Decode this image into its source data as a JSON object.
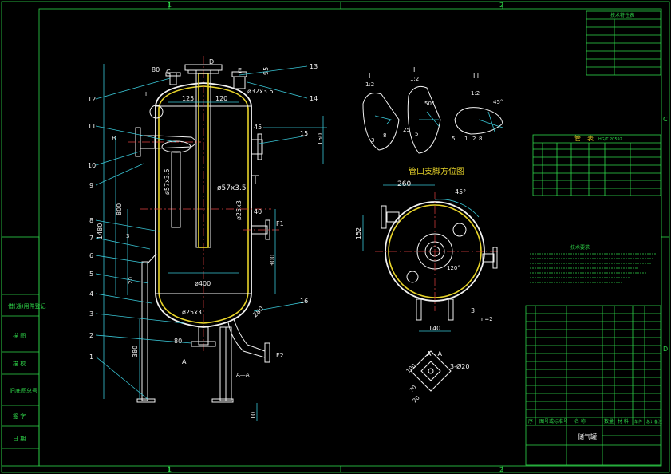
{
  "border_zones": {
    "top_1": "1",
    "top_2": "2",
    "bottom_1": "1",
    "bottom_2": "2",
    "right_c": "C",
    "right_d": "D"
  },
  "left_strip": [
    "借(通)用件登记",
    "描  图",
    "描  校",
    "旧底图总号",
    "签  字",
    "日  期"
  ],
  "vessel_labels": {
    "nozzle_c": "C",
    "nozzle_d": "D",
    "nozzle_e": "E",
    "nozzle_b": "B",
    "nozzle_f1": "F1",
    "nozzle_f2": "F2",
    "nozzle_a": "A",
    "section_aa": "A—A",
    "detail_i": "I"
  },
  "part_numbers": [
    "1",
    "2",
    "3",
    "4",
    "5",
    "6",
    "7",
    "8",
    "9",
    "10",
    "11",
    "12",
    "13",
    "14",
    "15",
    "16"
  ],
  "dims": {
    "d80_top": "80",
    "d95": "95",
    "d125": "125",
    "d120": "120",
    "d32": "ø32x3.5",
    "d45": "45",
    "d150": "150",
    "d800": "800",
    "d1480": "1480",
    "d57": "ø57x3.5",
    "d57b": "ø57x3.5",
    "d25a": "ø25x3",
    "d40": "40",
    "d300": "300",
    "d400": "ø400",
    "d25b": "ø25x3",
    "d280": "280",
    "d380": "380",
    "d80_bot": "80",
    "d10": "10",
    "d20": "20",
    "d3": "3"
  },
  "details": {
    "i_title": "I",
    "i_scale": "1:2",
    "ii_title": "II",
    "ii_scale": "1:2",
    "iii_title": "III",
    "iii_scale": "1:2",
    "d3": "3",
    "d8": "8",
    "d45": "45°",
    "d5": "5",
    "d25": "25",
    "d5b": "5",
    "d8b": "8",
    "d1": "1",
    "d2": "2",
    "d50": "50°"
  },
  "orientation": {
    "title": "管口支脚方位图",
    "d260": "260",
    "d45": "45°",
    "d152": "152",
    "d140": "140",
    "d120": "120°",
    "leg": "3",
    "n2": "n=2"
  },
  "aa_view": {
    "title": "A—A",
    "d100": "100",
    "d70": "70",
    "d20": "20",
    "d3o20": "3-Ø20"
  },
  "tech_table": {
    "title": "技术特性表",
    "rows": [
      [
        "",
        "",
        ""
      ],
      [
        "",
        "",
        ""
      ],
      [
        "",
        "",
        ""
      ],
      [
        "",
        "",
        ""
      ],
      [
        "",
        "",
        ""
      ],
      [
        "",
        "",
        ""
      ],
      [
        "",
        "",
        ""
      ]
    ]
  },
  "nozzle_table": {
    "title": "管口表",
    "subtitle": "HG/T 20592",
    "headers": [
      "",
      "",
      "",
      "",
      "",
      "",
      ""
    ],
    "rows": [
      [
        "",
        "",
        "",
        "",
        "",
        "",
        ""
      ],
      [
        "",
        "",
        "",
        "",
        "",
        "",
        ""
      ],
      [
        "",
        "",
        "",
        "",
        "",
        "",
        ""
      ],
      [
        "",
        "",
        "",
        "",
        "",
        "",
        ""
      ],
      [
        "",
        "",
        "",
        "",
        "",
        "",
        ""
      ],
      [
        "",
        "",
        "",
        "",
        "",
        "",
        ""
      ]
    ]
  },
  "tech_req_title": "技术要求",
  "bom_footer": [
    "序",
    "图号或标准号",
    "名    称",
    "数量",
    "材  料",
    "单件",
    "总计",
    "备注"
  ],
  "title_block": {
    "drawing_name": "储气罐",
    "scale": "",
    "sheet": "",
    "sig": "",
    "chk": ""
  }
}
